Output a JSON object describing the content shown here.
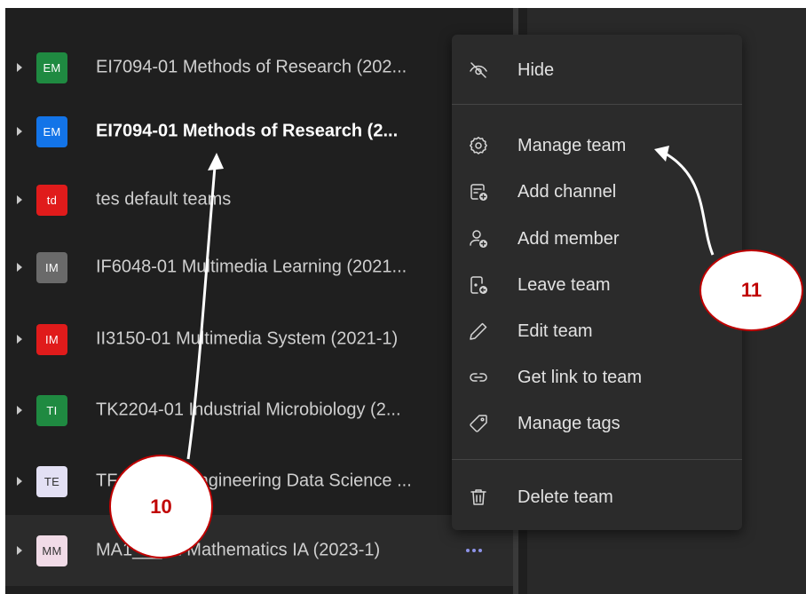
{
  "teams": [
    {
      "initials": "EM",
      "name": "EI7094-01 Methods of Research (202...",
      "avatar_bg": "#1f8a41",
      "avatar_fg": "#ffffff"
    },
    {
      "initials": "EM",
      "name": "EI7094-01 Methods of Research (2...",
      "avatar_bg": "#1374e8",
      "avatar_fg": "#ffffff",
      "selected": true
    },
    {
      "initials": "td",
      "name": "tes default teams",
      "avatar_bg": "#e01b1b",
      "avatar_fg": "#ffffff"
    },
    {
      "initials": "IM",
      "name": "IF6048-01 Multimedia Learning (2021...",
      "avatar_bg": "#6a6a6a",
      "avatar_fg": "#ffffff"
    },
    {
      "initials": "IM",
      "name": "II3150-01 Multimedia System (2021-1)",
      "avatar_bg": "#e01b1b",
      "avatar_fg": "#ffffff"
    },
    {
      "initials": "TI",
      "name": "TK2204-01 Industrial Microbiology (2...",
      "avatar_bg": "#1f8a41",
      "avatar_fg": "#ffffff"
    },
    {
      "initials": "TE",
      "name": "TF___ ___ Engineering Data Science ...",
      "avatar_bg": "#e3e0f4",
      "avatar_fg": "#333333"
    },
    {
      "initials": "MM",
      "name": "MA1___01 Mathematics IA (2023-1)",
      "avatar_bg": "#f1dbe7",
      "avatar_fg": "#333333",
      "hovered": true
    }
  ],
  "more_options_icon": "ellipsis-icon",
  "accent_color": "#8d93e8",
  "context_menu": {
    "items": [
      {
        "label": "Hide",
        "icon": "eye-off-icon"
      },
      {
        "label": "Manage team",
        "icon": "gear-icon"
      },
      {
        "label": "Add channel",
        "icon": "add-channel-icon"
      },
      {
        "label": "Add member",
        "icon": "add-member-icon"
      },
      {
        "label": "Leave team",
        "icon": "leave-team-icon"
      },
      {
        "label": "Edit team",
        "icon": "pencil-icon"
      },
      {
        "label": "Get link to team",
        "icon": "link-icon"
      },
      {
        "label": "Manage tags",
        "icon": "tag-icon"
      },
      {
        "label": "Delete team",
        "icon": "trash-icon"
      }
    ]
  },
  "annotations": [
    {
      "label": "10",
      "color": "#c00000"
    },
    {
      "label": "11",
      "color": "#c00000"
    }
  ]
}
